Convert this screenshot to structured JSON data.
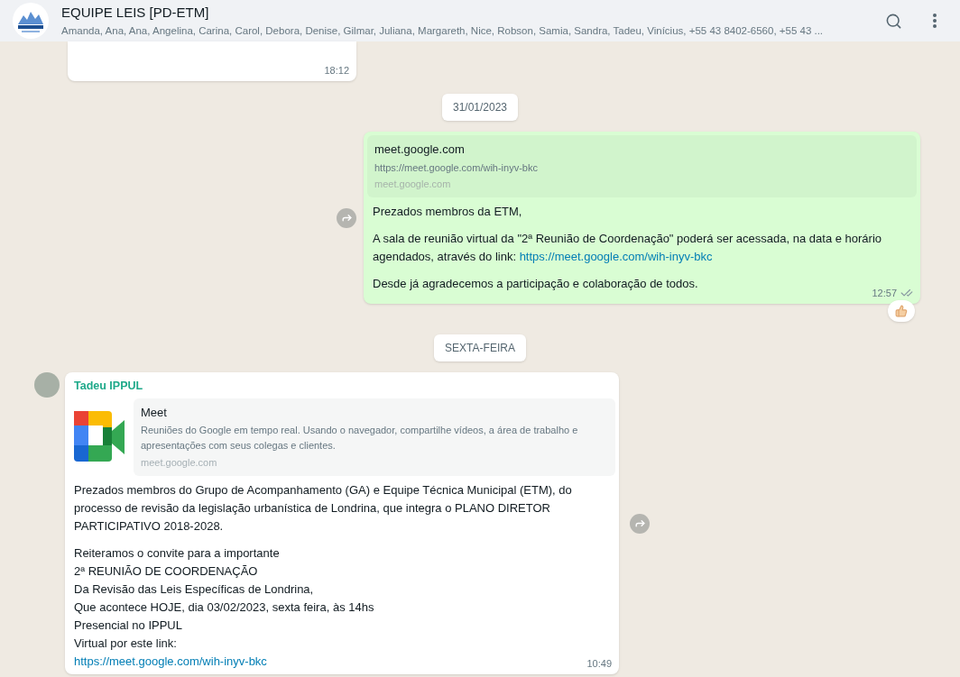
{
  "header": {
    "title": "EQUIPE LEIS [PD-ETM]",
    "members": "Amanda, Ana, Ana, Angelina, Carina, Carol, Debora, Denise, Gilmar, Juliana, Margareth, Nice, Robson, Samia, Sandra, Tadeu, Vinícius, +55 43 8402-6560, +55 43 ..."
  },
  "messages": [
    {
      "kind": "partial",
      "time": "18:12"
    },
    {
      "kind": "date",
      "label": "31/01/2023"
    },
    {
      "kind": "outgoing",
      "time": "12:57",
      "reacted": true,
      "preview": {
        "title": "meet.google.com",
        "description": "https://meet.google.com/wih-inyv-bkc",
        "site": "meet.google.com"
      },
      "paragraphs": [
        {
          "lines": [
            "Prezados membros da ETM,"
          ]
        },
        {
          "lines": [
            "A sala de reunião virtual da \"2ª Reunião de Coordenação\" poderá ser acessada, na data e horário agendados, através do link:"
          ],
          "link": "https://meet.google.com/wih-inyv-bkc",
          "inline": true
        },
        {
          "lines": [
            "Desde já agradecemos a participação e colaboração de todos."
          ]
        }
      ]
    },
    {
      "kind": "date",
      "label": "SEXTA-FEIRA"
    },
    {
      "kind": "incoming",
      "sender": "Tadeu IPPUL",
      "time": "10:49",
      "preview": {
        "title": "Meet",
        "description": "Reuniões do Google em tempo real. Usando o navegador, compartilhe vídeos, a área de trabalho e apresentações com seus colegas e clientes.",
        "site": "meet.google.com"
      },
      "paragraphs": [
        {
          "lines": [
            "Prezados membros do Grupo de Acompanhamento (GA) e Equipe Técnica Municipal (ETM), do processo de revisão da legislação urbanística de Londrina, que integra o PLANO DIRETOR PARTICIPATIVO 2018-2028."
          ]
        },
        {
          "lines": [
            "Reiteramos o convite para a importante",
            "2ª REUNIÃO DE COORDENAÇÃO",
            "Da Revisão das Leis Específicas de Londrina,",
            "Que acontece HOJE, dia 03/02/2023, sexta feira, às 14hs",
            "Presencial no IPPUL",
            "Virtual por este link:"
          ],
          "link": "https://meet.google.com/wih-inyv-bkc",
          "inline": false
        }
      ]
    }
  ]
}
